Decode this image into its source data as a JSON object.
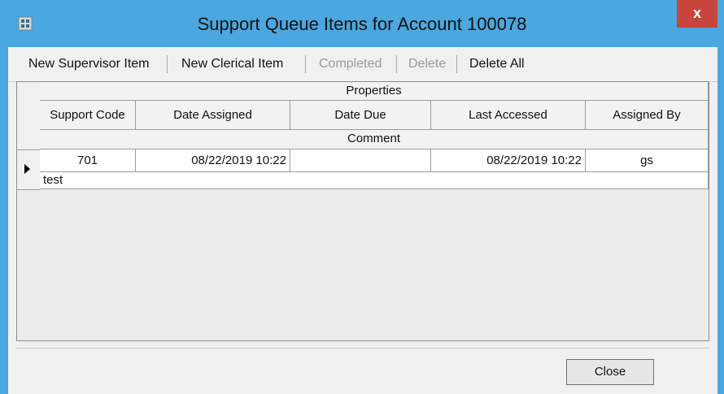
{
  "window": {
    "title": "Support Queue Items for Account 100078",
    "close_glyph": "x",
    "app_icon": "app-icon",
    "accent": "#4aa7df"
  },
  "toolbar": {
    "new_supervisor_label": "New Supervisor Item",
    "new_clerical_label": "New Clerical Item",
    "completed_label": "Completed",
    "delete_label": "Delete",
    "delete_all_label": "Delete All"
  },
  "grid": {
    "band_header": "Properties",
    "columns": [
      "Support Code",
      "Date Assigned",
      "Date Due",
      "Last Accessed",
      "Assigned By"
    ],
    "comment_header": "Comment",
    "rows": [
      {
        "support_code": "701",
        "date_assigned": "08/22/2019 10:22",
        "date_due": "",
        "last_accessed": "08/22/2019 10:22",
        "assigned_by": "gs",
        "comment": "test"
      }
    ]
  },
  "footer": {
    "close_label": "Close"
  }
}
